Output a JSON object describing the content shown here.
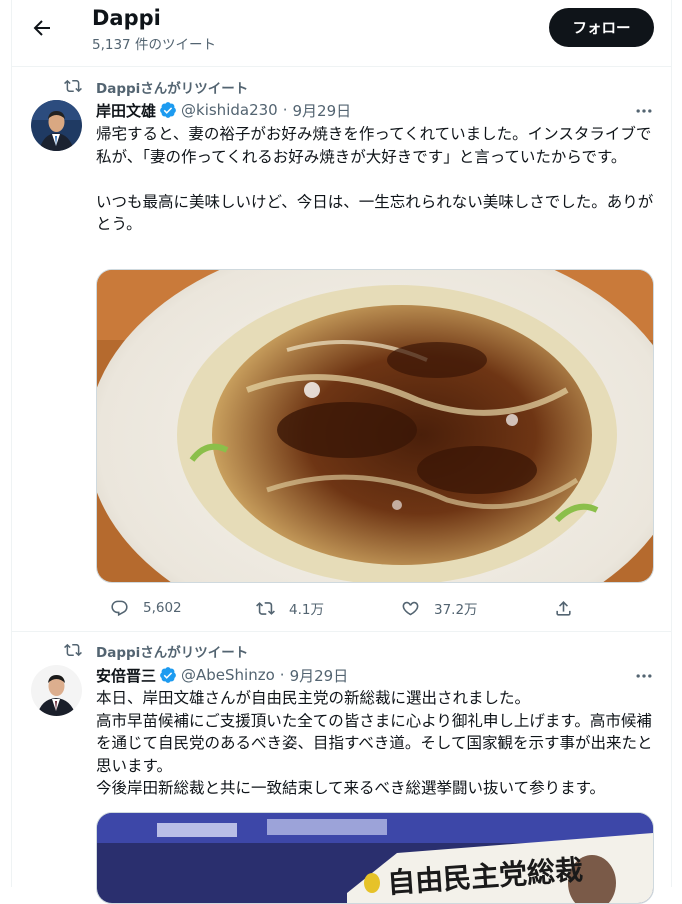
{
  "header": {
    "title": "Dappi",
    "tweet_count": "5,137 件のツイート",
    "follow_label": "フォロー"
  },
  "tweets": [
    {
      "retweet_label": "Dappiさんがリツイート",
      "author_name": "岸田文雄",
      "author_handle": "@kishida230",
      "separator": "·",
      "date": "9月29日",
      "text": "帰宅すると、妻の裕子がお好み焼きを作ってくれていました。インスタライブで私が、「妻の作ってくれるお好み焼きが大好きです」と言っていたからです。\n\nいつも最高に美味しいけど、今日は、一生忘れられない美味しさでした。ありがとう。",
      "replies": "5,602",
      "retweets": "4.1万",
      "likes": "37.2万"
    },
    {
      "retweet_label": "Dappiさんがリツイート",
      "author_name": "安倍晋三",
      "author_handle": "@AbeShinzo",
      "separator": "·",
      "date": "9月29日",
      "text": "本日、岸田文雄さんが自由民主党の新総裁に選出されました。\n高市早苗候補にご支援頂いた全ての皆さまに心より御礼申し上げます。高市候補を通じて自民党のあるべき姿、目指すべき道。そして国家観を示す事が出来たと思います。\n今後岸田新総裁と共に一致結束して来るべき総選挙闘い抜いて参ります。",
      "media_banner_text": "自由民主党総裁"
    }
  ],
  "colors": {
    "text": "#0f1419",
    "secondary": "#536471",
    "verified": "#1d9bf0",
    "border": "#eff3f4",
    "follow_bg": "#0f1419"
  },
  "icons": [
    "back-arrow-icon",
    "retweet-icon",
    "verified-icon",
    "more-icon",
    "reply-icon",
    "like-icon",
    "share-icon"
  ]
}
